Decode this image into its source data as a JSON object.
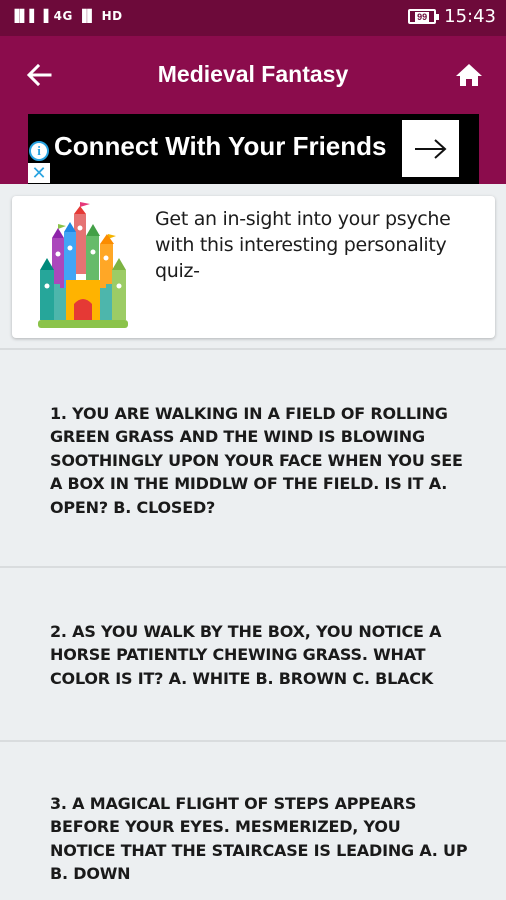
{
  "status_bar": {
    "left_indicators": "▐▌▌▐ 4G ▐▌ HD",
    "battery": "99",
    "time": "15:43"
  },
  "app_bar": {
    "title": "Medieval Fantasy",
    "back_icon": "arrow-left-icon",
    "home_icon": "home-icon"
  },
  "ad": {
    "text": "Connect With Your Friends",
    "info_glyph": "i",
    "close_glyph": "✕"
  },
  "intro_card": {
    "text": "Get an in-sight into your psyche with this interesting personality quiz-",
    "image": "castle-icon"
  },
  "questions": [
    {
      "text": "1. YOU ARE WALKING IN A FIELD OF ROLLING GREEN GRASS AND THE WIND IS BLOWING SOOTHINGLY UPON YOUR FACE WHEN YOU SEE A BOX IN THE MIDDLW OF THE FIELD. IS IT A. OPEN? B. CLOSED?"
    },
    {
      "text": "2. AS YOU WALK BY THE BOX, YOU NOTICE A HORSE PATIENTLY CHEWING  GRASS. WHAT COLOR IS IT? A. WHITE B. BROWN C. BLACK"
    },
    {
      "text": "3. A MAGICAL FLIGHT OF STEPS APPEARS BEFORE YOUR EYES. MESMERIZED, YOU NOTICE THAT THE STAIRCASE IS LEADING A. UP B. DOWN"
    }
  ],
  "colors": {
    "status_bar": "#6d0a3a",
    "app_bar": "#8b0c4c",
    "background": "#eceff1"
  }
}
